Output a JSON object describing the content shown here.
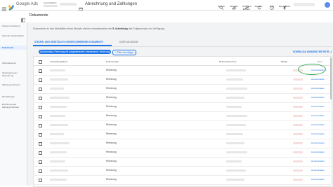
{
  "header": {
    "app_name": "Google Ads",
    "account_label": "conversations",
    "page_title": "Abrechnung und Zahlungen",
    "actions": [
      {
        "icon": "search-icon",
        "label": "Suchen"
      },
      {
        "icon": "chart-icon",
        "label": "Berichte"
      },
      {
        "icon": "wrench-icon",
        "label": "Tools und Einstell."
      },
      {
        "icon": "refresh-icon",
        "label": "Aktualis..."
      },
      {
        "icon": "help-icon",
        "label": "Hilfe"
      },
      {
        "icon": "bell-icon",
        "label": "Benachricht..."
      }
    ]
  },
  "breadcrumb": {
    "title": "Dokumente"
  },
  "sidebar": {
    "items": [
      {
        "label": "Zusammenfassung",
        "active": false
      },
      {
        "label": "Abrechnungsaktivitäten",
        "active": false
      },
      {
        "label": "Dokumente",
        "active": true
      },
      {
        "label": "Werbeaktionen",
        "active": false
      },
      {
        "label": "Übertragung der Abrechnung",
        "active": false
      },
      {
        "label": "Zahlungsmethoden",
        "active": false
      },
      {
        "label": "Einstellungen",
        "active": false
      },
      {
        "label": "Einrichtung der Zahlungsmethode",
        "active": false
      }
    ]
  },
  "notice": {
    "text_before": "Dokumente zu den Aktivitäten eines Monats stehen normalerweise am ",
    "bold": "5. Arbeitstag",
    "text_after": " des Folgemonats zur Verfügung."
  },
  "tabs": [
    {
      "label": "STEUER- UND GESETZLICH VORGESCHRIEBENE DOKUMENTE",
      "active": true
    },
    {
      "label": "KONTOAUSZÜGE",
      "active": false
    }
  ],
  "toolbar": {
    "filter_chip": "Dokumenttyp: Rechnung mit ausgewiesener Umsatzsteuer, Rechnung",
    "add_filter": "+ Filter hinzufügen",
    "download_all": "DOWNLOAD (GEWÄHLTER ZEITR...)"
  },
  "table": {
    "columns": [
      "Ausstellungsdatum",
      "Dokumenttyp",
      "Dokumentnummer",
      "Betrag",
      "Aktion"
    ],
    "rows": [
      {
        "type": "Rechnung",
        "action": "Herunterladen"
      },
      {
        "type": "Rechnung",
        "action": "Herunterladen"
      },
      {
        "type": "Rechnung",
        "action": "Herunterladen"
      },
      {
        "type": "Rechnung",
        "action": "Herunterladen"
      },
      {
        "type": "Rechnung",
        "action": "Herunterladen"
      },
      {
        "type": "Rechnung",
        "action": "Herunterladen"
      },
      {
        "type": "Rechnung",
        "action": "Herunterladen"
      },
      {
        "type": "Rechnung",
        "action": "Herunterladen"
      },
      {
        "type": "Rechnung",
        "action": "Herunterladen"
      },
      {
        "type": "Rechnung",
        "action": "Herunterladen"
      },
      {
        "type": "Rechnung",
        "action": "Herunterladen"
      },
      {
        "type": "Rechnung",
        "action": "Herunterladen"
      },
      {
        "type": "Rechnung",
        "action": "Herunterladen"
      }
    ]
  },
  "colors": {
    "accent": "#1a73e8",
    "highlight_circle": "#34a853"
  }
}
